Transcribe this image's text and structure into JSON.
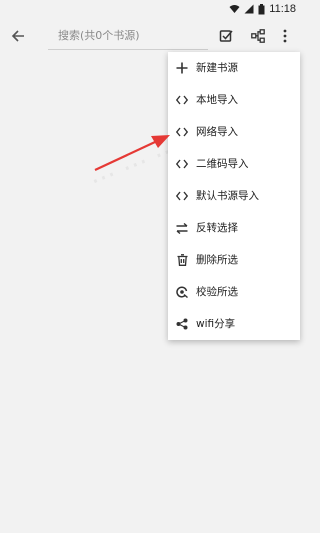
{
  "status_bar": {
    "time": "11:18"
  },
  "search": {
    "placeholder": "搜索(共0个书源)"
  },
  "menu": {
    "items": [
      {
        "label": "新建书源",
        "icon": "plus-icon"
      },
      {
        "label": "本地导入",
        "icon": "code-brackets-icon"
      },
      {
        "label": "网络导入",
        "icon": "code-brackets-icon"
      },
      {
        "label": "二维码导入",
        "icon": "code-brackets-icon"
      },
      {
        "label": "默认书源导入",
        "icon": "code-brackets-icon"
      },
      {
        "label": "反转选择",
        "icon": "swap-arrows-icon"
      },
      {
        "label": "删除所选",
        "icon": "trash-icon"
      },
      {
        "label": "校验所选",
        "icon": "verify-icon"
      },
      {
        "label": "wifi分享",
        "icon": "share-icon"
      }
    ]
  },
  "annotation": {
    "color": "#e53935",
    "points_to": "网络导入"
  },
  "colors": {
    "background": "#f2f2f2",
    "menu_background": "#ffffff",
    "text": "#1e1e1e"
  }
}
